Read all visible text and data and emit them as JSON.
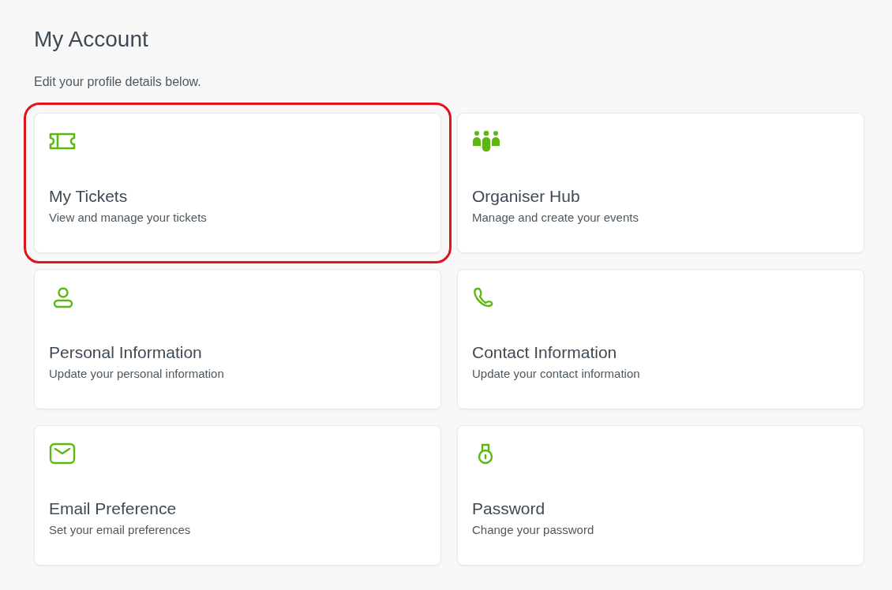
{
  "page": {
    "title": "My Account",
    "subtitle": "Edit your profile details below."
  },
  "cards": [
    {
      "kind": "ticket",
      "title": "My Tickets",
      "description": "View and manage your tickets",
      "selected": true
    },
    {
      "kind": "group",
      "title": "Organiser Hub",
      "description": "Manage and create your events",
      "selected": false
    },
    {
      "kind": "person",
      "title": "Personal Information",
      "description": "Update your personal information",
      "selected": false
    },
    {
      "kind": "phone",
      "title": "Contact Information",
      "description": "Update your contact information",
      "selected": false
    },
    {
      "kind": "mail",
      "title": "Email Preference",
      "description": "Set your email preferences",
      "selected": false
    },
    {
      "kind": "lock",
      "title": "Password",
      "description": "Change your password",
      "selected": false
    }
  ]
}
